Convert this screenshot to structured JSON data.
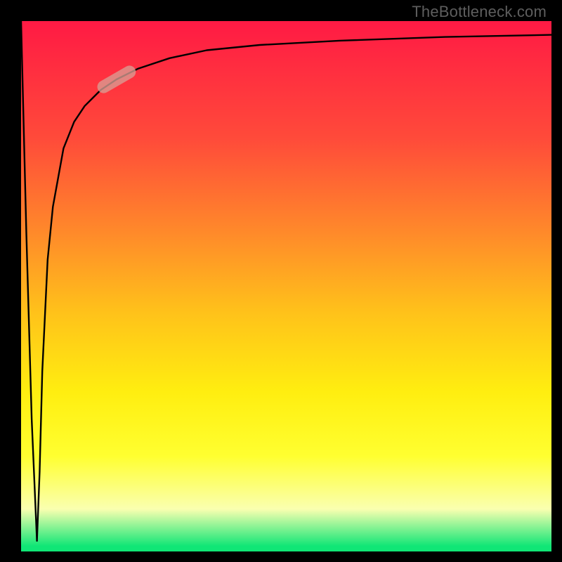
{
  "attribution": "TheBottleneck.com",
  "colors": {
    "background": "#000000",
    "gradient_top": "#ff1a44",
    "gradient_mid": "#ffee10",
    "gradient_bottom": "#10e676",
    "curve": "#000000",
    "marker_fill": "#d99e93",
    "marker_alpha": 0.78
  },
  "chart_data": {
    "type": "line",
    "title": "",
    "xlabel": "",
    "ylabel": "",
    "xlim": [
      0,
      100
    ],
    "ylim": [
      0,
      100
    ],
    "grid": false,
    "note": "Single black curve on a vertical red→yellow→green gradient. Curve drops sharply from the top-left to near the bottom at x≈3, then rises steeply and asymptotes near y≈97 toward the right edge. A short rounded translucent marker sits on the curve near x≈18.",
    "series": [
      {
        "name": "curve",
        "x": [
          0,
          1,
          2,
          3,
          3.5,
          4,
          5,
          6,
          8,
          10,
          12,
          15,
          18,
          22,
          28,
          35,
          45,
          60,
          80,
          100
        ],
        "values": [
          100,
          60,
          25,
          2,
          15,
          34,
          55,
          65,
          76,
          81,
          84,
          87,
          89,
          91,
          93,
          94.5,
          95.5,
          96.3,
          97,
          97.4
        ]
      }
    ],
    "marker": {
      "x": 18,
      "y": 89,
      "angle_deg": 30,
      "length_pct": 8
    }
  }
}
